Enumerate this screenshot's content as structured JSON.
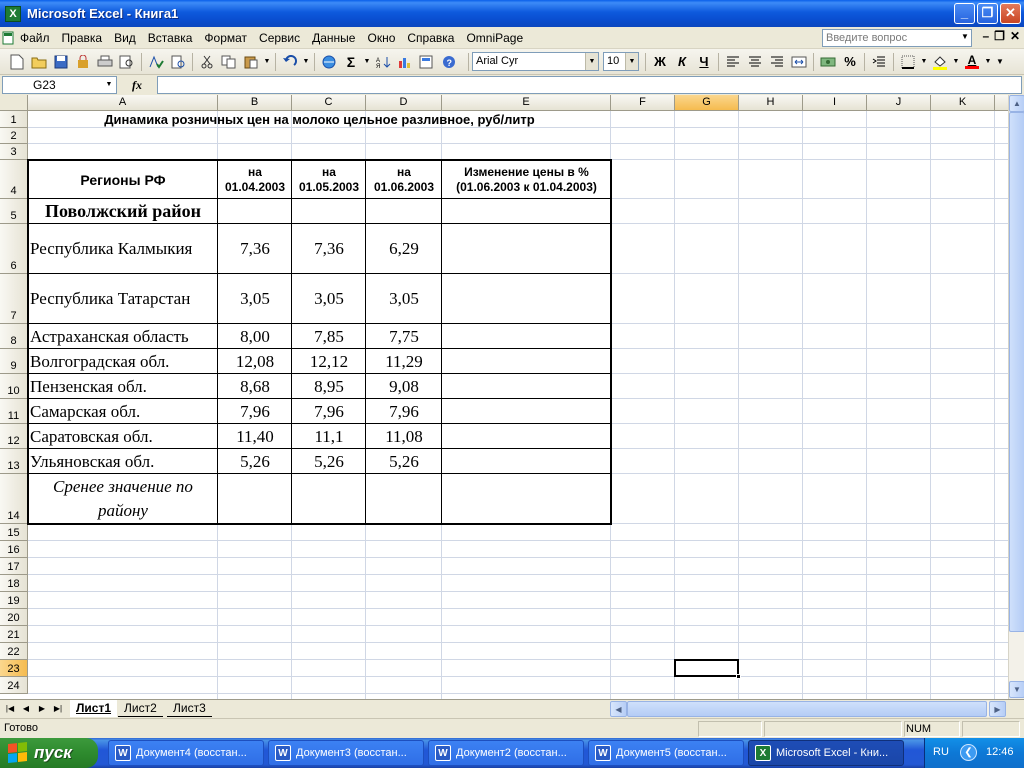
{
  "window": {
    "title": "Microsoft Excel - Книга1",
    "app_icon": "X",
    "minimize": "_",
    "restore": "❐",
    "close": "✕"
  },
  "menu": {
    "items": [
      "Файл",
      "Правка",
      "Вид",
      "Вставка",
      "Формат",
      "Сервис",
      "Данные",
      "Окно",
      "Справка",
      "OmniPage"
    ],
    "help_placeholder": "Введите вопрос",
    "mdi_min": "–",
    "mdi_restore": "❐",
    "mdi_close": "✕"
  },
  "toolbar": {
    "font_name": "Arial Cyr",
    "font_size": "10",
    "bold": "Ж",
    "italic": "К",
    "underline": "Ч",
    "autosum": "Σ",
    "percent": "%",
    "font_color_letter": "A",
    "fill_color": "#FFFF00",
    "font_color": "#FF0000"
  },
  "formula_bar": {
    "cell_ref": "G23",
    "fx": "fx",
    "value": ""
  },
  "grid": {
    "columns": [
      "A",
      "B",
      "C",
      "D",
      "E",
      "F",
      "G",
      "H",
      "I",
      "J",
      "K"
    ],
    "active_column": "G",
    "rows": [
      "1",
      "2",
      "3",
      "4",
      "5",
      "6",
      "7",
      "8",
      "9",
      "10",
      "11",
      "12",
      "13",
      "14",
      "15",
      "16",
      "17",
      "18",
      "19",
      "20",
      "21",
      "22",
      "23",
      "24"
    ],
    "active_row": "23"
  },
  "sheet": {
    "title": "Динамика розничных цен на молоко цельное разливное, руб/литр",
    "header_region": "Регионы РФ",
    "header_b": [
      "на",
      "01.04.2003"
    ],
    "header_c": [
      "на",
      "01.05.2003"
    ],
    "header_d": [
      "на",
      "01.06.2003"
    ],
    "header_e": [
      "Изменение цены в %",
      "(01.06.2003 к 01.04.2003)"
    ],
    "section": "Поволжский район",
    "rows": [
      {
        "region": "Республика Калмыкия",
        "b": "7,36",
        "c": "7,36",
        "d": "6,29"
      },
      {
        "region": "Республика Татарстан",
        "b": "3,05",
        "c": "3,05",
        "d": "3,05"
      },
      {
        "region": "Астраханская область",
        "b": "8,00",
        "c": "7,85",
        "d": "7,75"
      },
      {
        "region": "Волгоградская обл.",
        "b": "12,08",
        "c": "12,12",
        "d": "11,29"
      },
      {
        "region": "Пензенская обл.",
        "b": "8,68",
        "c": "8,95",
        "d": "9,08"
      },
      {
        "region": "Самарская обл.",
        "b": "7,96",
        "c": "7,96",
        "d": "7,96"
      },
      {
        "region": "Саратовская обл.",
        "b": "11,40",
        "c": "11,1",
        "d": "11,08"
      },
      {
        "region": "Ульяновская обл.",
        "b": "5,26",
        "c": "5,26",
        "d": "5,26"
      }
    ],
    "average_line1": "Сренее значение по",
    "average_line2": "району"
  },
  "tabs": {
    "sheets": [
      "Лист1",
      "Лист2",
      "Лист3"
    ],
    "active": "Лист1"
  },
  "status": {
    "text": "Готово",
    "num": "NUM"
  },
  "taskbar": {
    "start": "пуск",
    "buttons": [
      {
        "label": "Документ4 (восстан...",
        "icon": "W"
      },
      {
        "label": "Документ3 (восстан...",
        "icon": "W"
      },
      {
        "label": "Документ2 (восстан...",
        "icon": "W"
      },
      {
        "label": "Документ5 (восстан...",
        "icon": "W"
      },
      {
        "label": "Microsoft Excel - Кни...",
        "icon": "X"
      }
    ],
    "lang": "RU",
    "clock": "12:46"
  }
}
